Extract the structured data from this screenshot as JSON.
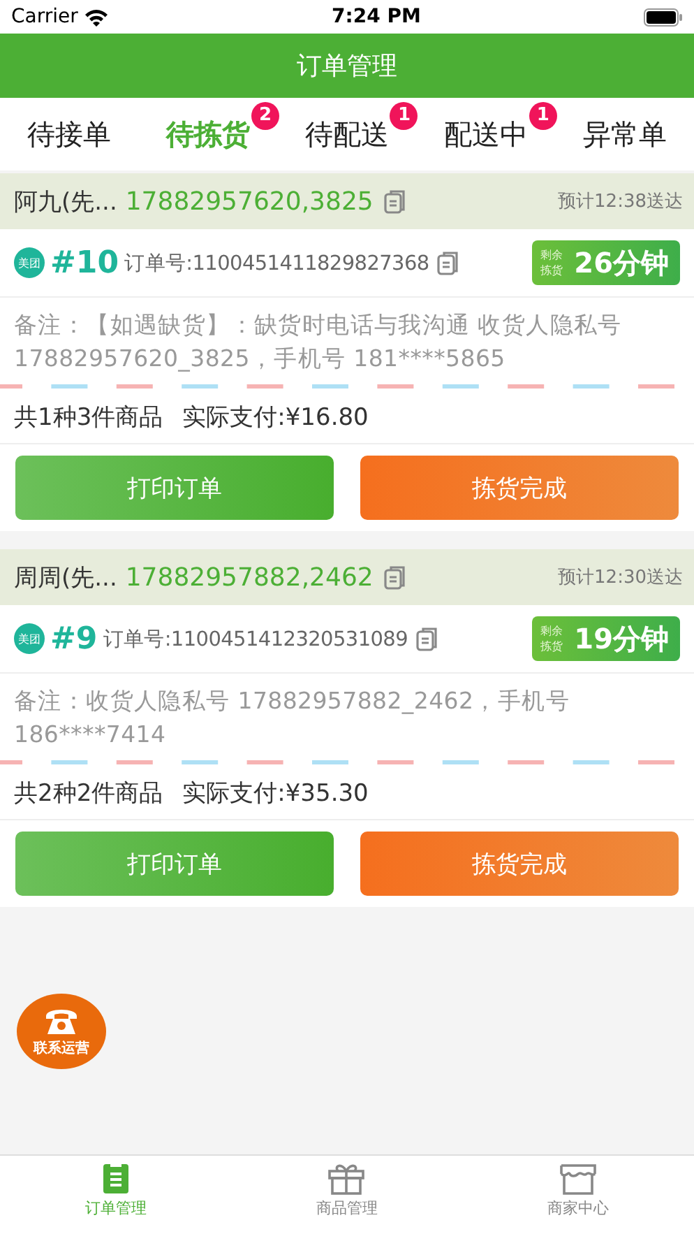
{
  "status_bar": {
    "carrier": "Carrier",
    "time": "7:24 PM"
  },
  "nav": {
    "title": "订单管理"
  },
  "tabs": [
    {
      "label": "待接单",
      "selected": false
    },
    {
      "label": "待拣货",
      "selected": true,
      "badge": "2"
    },
    {
      "label": "待配送",
      "selected": false,
      "badge": "1"
    },
    {
      "label": "配送中",
      "selected": false,
      "badge": "1"
    },
    {
      "label": "异常单",
      "selected": false
    }
  ],
  "orders": [
    {
      "customer": "阿九(先...",
      "phone": "17882957620,3825",
      "eta": "预计12:38送达",
      "platform": "美团",
      "number": "#10",
      "order_no": "订单号:1100451411829827368",
      "timer_label": [
        "剩余",
        "拣货"
      ],
      "timer": "26分钟",
      "note": "备注：【如遇缺货】：缺货时电话与我沟通 收货人隐私号 17882957620_3825，手机号 181****5865",
      "items": "共1种3件商品",
      "paid": "实际支付:¥16.80",
      "buttons": [
        "打印订单",
        "拣货完成"
      ]
    },
    {
      "customer": "周周(先...",
      "phone": "17882957882,2462",
      "eta": "预计12:30送达",
      "platform": "美团",
      "number": "#9",
      "order_no": "订单号:1100451412320531089",
      "timer_label": [
        "剩余",
        "拣货"
      ],
      "timer": "19分钟",
      "note": "备注：收货人隐私号 17882957882_2462，手机号 186****7414",
      "items": "共2种2件商品",
      "paid": "实际支付:¥35.30",
      "buttons": [
        "打印订单",
        "拣货完成"
      ]
    }
  ],
  "float_button": {
    "label": "联系运营"
  },
  "bottom_tabs": [
    {
      "label": "订单管理",
      "selected": true,
      "kind": "clipboard"
    },
    {
      "label": "商品管理",
      "selected": false,
      "kind": "gift"
    },
    {
      "label": "商家中心",
      "selected": false,
      "kind": "store"
    }
  ]
}
